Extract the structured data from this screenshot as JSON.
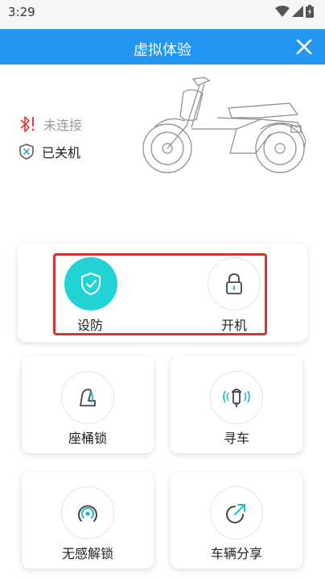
{
  "status_bar": {
    "time": "3:29"
  },
  "header": {
    "title": "虚拟体验"
  },
  "vehicle_status": {
    "bluetooth": "未连接",
    "power": "已关机"
  },
  "actions": {
    "arm": "设防",
    "power_on": "开机"
  },
  "grid": [
    {
      "label": "座桶锁",
      "icon": "seat-lock-icon"
    },
    {
      "label": "寻车",
      "icon": "find-car-icon"
    },
    {
      "label": "无感解锁",
      "icon": "sensorless-unlock-icon"
    },
    {
      "label": "车辆分享",
      "icon": "share-icon"
    }
  ],
  "colors": {
    "header": "#2196f3",
    "accent": "#22d3d6",
    "bluetooth_alert": "#e53935",
    "highlight_box": "#d9342b"
  }
}
